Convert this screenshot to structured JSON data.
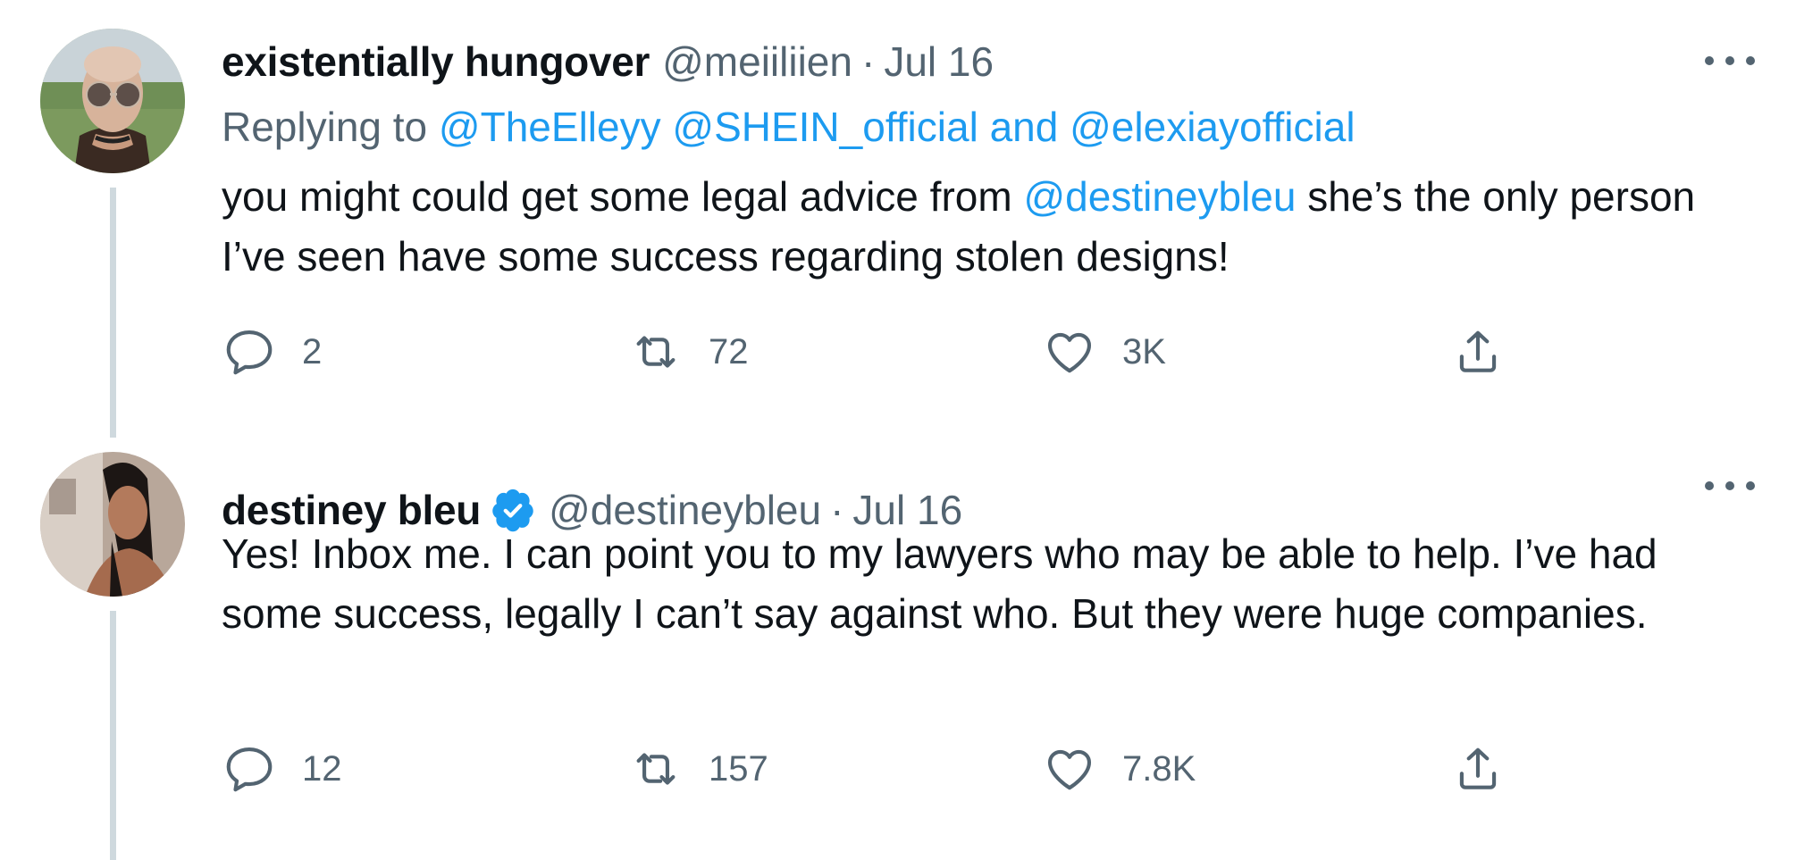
{
  "colors": {
    "link": "#1d9bf0",
    "secondary_text": "#536471",
    "primary_text": "#0f1419",
    "thread_line": "#cfd9de",
    "verified": "#1d9bf0"
  },
  "tweets": [
    {
      "display_name": "existentially hungover",
      "handle": "@meiiliien",
      "separator": "·",
      "date": "Jul 16",
      "verified": false,
      "replying_prefix": "Replying to",
      "replying_to": [
        "@TheElleyy",
        "@SHEIN_official"
      ],
      "replying_and": "and",
      "replying_last": "@elexiayofficial",
      "body": {
        "part1": "you might could get some legal advice from",
        "mention": "@destineybleu",
        "part2": "she’s the only person I’ve seen have some success regarding stolen designs!"
      },
      "actions": {
        "replies": "2",
        "retweets": "72",
        "likes": "3K"
      },
      "icons": [
        "comment-icon",
        "retweet-icon",
        "heart-icon",
        "share-icon",
        "more-icon"
      ]
    },
    {
      "display_name": "destiney bleu",
      "handle": "@destineybleu",
      "separator": "·",
      "date": "Jul 16",
      "verified": true,
      "body": {
        "text": "Yes! Inbox me. I can point you to my lawyers who may be able to help. I’ve had some success, legally I can’t say against who. But they were huge companies."
      },
      "actions": {
        "replies": "12",
        "retweets": "157",
        "likes": "7.8K"
      },
      "icons": [
        "comment-icon",
        "retweet-icon",
        "heart-icon",
        "share-icon",
        "more-icon",
        "verified-badge-icon"
      ]
    }
  ]
}
